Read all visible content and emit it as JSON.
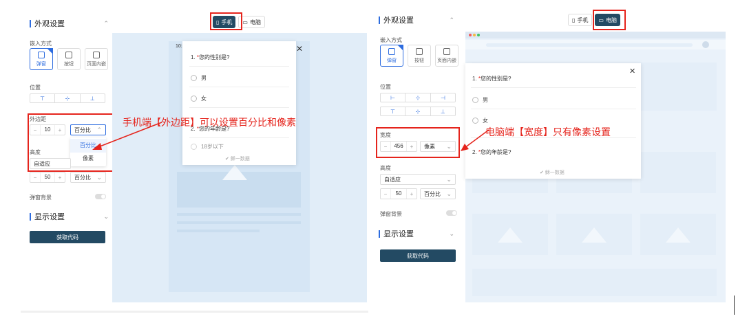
{
  "left": {
    "section_title": "外观设置",
    "embed_label": "嵌入方式",
    "embed_options": [
      "弹窗",
      "按钮",
      "页面内嵌"
    ],
    "position_label": "位置",
    "margin_label": "外边距",
    "margin_value": "10",
    "unit_selected": "百分比",
    "unit_options": [
      "百分比",
      "像素"
    ],
    "height_label": "高度",
    "height_value": "自适应",
    "stepper2_value": "50",
    "stepper2_unit": "百分比",
    "popup_bg_label": "弹窗背景",
    "display_settings": "显示设置",
    "get_code": "获取代码"
  },
  "center": {
    "device_mobile": "手机",
    "device_pc": "电脑",
    "status_time": "10:",
    "q1": "1. ",
    "q1_text": "您的性别是?",
    "opt_male": "男",
    "opt_female": "女",
    "q2": "2. ",
    "q2_text": "您的年龄是?",
    "q2_partial_option": "18岁以下",
    "powered": "稣一数据"
  },
  "annotations": {
    "mobile_note": "手机端【外边距】可以设置百分比和像素",
    "pc_note": "电脑端【宽度】只有像素设置"
  },
  "right": {
    "section_title": "外观设置",
    "embed_label": "嵌入方式",
    "embed_options": [
      "弹窗",
      "按钮",
      "页面内嵌"
    ],
    "position_label": "位置",
    "width_label": "宽度",
    "width_value": "456",
    "width_unit": "像素",
    "height_label": "高度",
    "height_value": "自适应",
    "stepper2_value": "50",
    "stepper2_unit": "百分比",
    "popup_bg_label": "弹窗背景",
    "display_settings": "显示设置",
    "get_code": "获取代码",
    "device_mobile": "手机",
    "device_pc": "电脑",
    "q1": "1. ",
    "q1_text": "您的性别是?",
    "opt_male": "男",
    "opt_female": "女",
    "q2": "2. ",
    "q2_text": "您的年龄是?",
    "powered": "稣一数据"
  },
  "colors": {
    "accent_blue": "#2d6cdf",
    "dark_button": "#234a63",
    "annotation_red": "#e5241c",
    "preview_bg": "#dbe9f6"
  }
}
